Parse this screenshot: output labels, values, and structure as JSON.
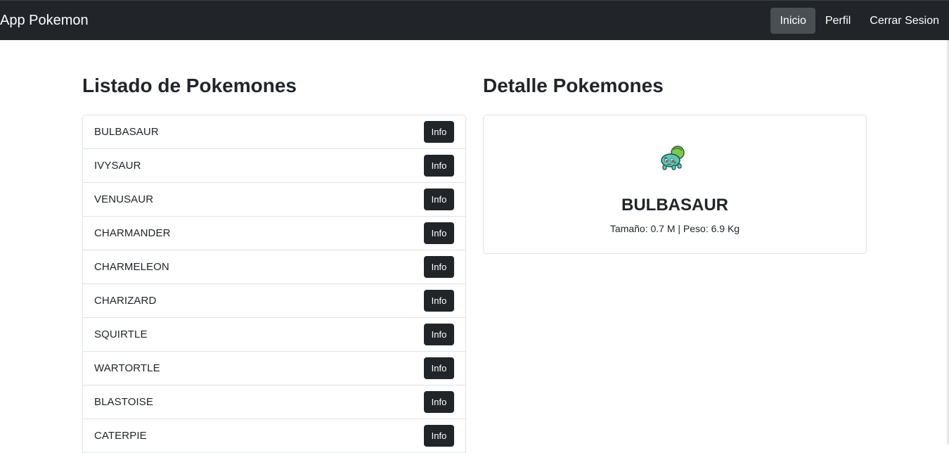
{
  "navbar": {
    "brand": "App Pokemon",
    "links": [
      {
        "label": "Inicio",
        "active": true
      },
      {
        "label": "Perfil",
        "active": false
      },
      {
        "label": "Cerrar Sesion",
        "active": false
      }
    ]
  },
  "list_section": {
    "title": "Listado de Pokemones",
    "button_label": "Info",
    "items": [
      "BULBASAUR",
      "IVYSAUR",
      "VENUSAUR",
      "CHARMANDER",
      "CHARMELEON",
      "CHARIZARD",
      "SQUIRTLE",
      "WARTORTLE",
      "BLASTOISE",
      "CATERPIE"
    ]
  },
  "detail_section": {
    "title": "Detalle Pokemones",
    "name": "BULBASAUR",
    "stats": "Tamaño: 0.7 M | Peso: 6.9 Kg",
    "sprite_icon": "bulbasaur-sprite-icon"
  },
  "colors": {
    "navbar_bg": "#212529",
    "button_bg": "#212529",
    "active_link_bg": "#4a4f54",
    "border": "#dee2e6"
  }
}
